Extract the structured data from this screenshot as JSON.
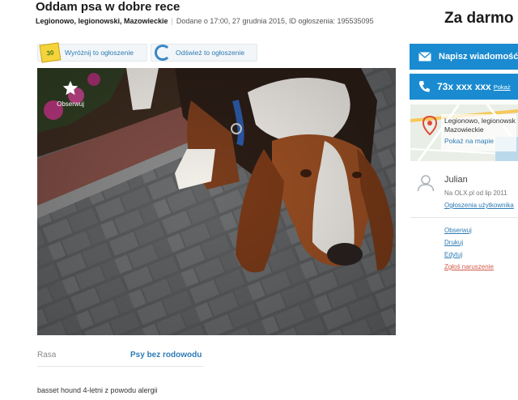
{
  "ad": {
    "title": "Oddam psa w dobre rece",
    "location": "Legionowo, legionowski, Mazowieckie",
    "added": "Dodane o 17:00, 27 grudnia 2015, ID ogłoszenia: 195535095",
    "price": "Za darmo"
  },
  "toolbar": {
    "promote_badge": "30",
    "promote_label": "Wyróżnij to ogłoszenie",
    "refresh_label": "Odśwież to ogłoszenie"
  },
  "photo": {
    "observe_label": "Obserwuj"
  },
  "attributes": {
    "label": "Rasa",
    "value": "Psy bez rodowodu"
  },
  "description": "basset hound 4-letni z powodu alergii",
  "sidebar": {
    "message_label": "Napisz wiadomość",
    "phone_label": "73x xxx xxx",
    "phone_show": "Pokaż",
    "map_location_line1": "Legionowo, legionowsk",
    "map_location_line2": "Mazowieckie",
    "map_link": "Pokaż na mapie",
    "user_name": "Julian",
    "user_since": "Na OLX.pl od lip 2011",
    "user_ads": "Ogłoszenia użytkownika",
    "links": [
      "Obserwuj",
      "Drukuj",
      "Edytuj",
      "Zgłoś naruszenie"
    ]
  },
  "colors": {
    "accent": "#1a8bd0",
    "link": "#2e7bb5",
    "report": "#d15a4a"
  }
}
